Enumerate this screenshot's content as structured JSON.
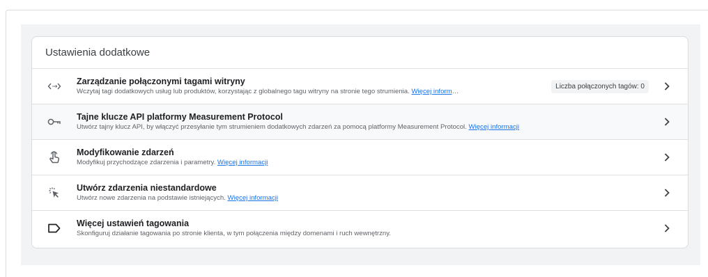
{
  "card": {
    "title": "Ustawienia dodatkowe"
  },
  "rows": [
    {
      "icon": "code-brackets-icon",
      "title": "Zarządzanie połączonymi tagami witryny",
      "description": "Wczytaj tagi dodatkowych usług lub produktów, korzystając z globalnego tagu witryny na stronie tego strumienia. ",
      "link": "Więcej inform",
      "ellipsis": "…",
      "badge": "Liczba połączonych tagów: 0"
    },
    {
      "icon": "key-icon",
      "title": "Tajne klucze API platformy Measurement Protocol",
      "description": "Utwórz tajny klucz API, by włączyć przesyłanie tym strumieniem dodatkowych zdarzeń za pomocą platformy Measurement Protocol. ",
      "link": "Więcej informacji"
    },
    {
      "icon": "touch-hand-icon",
      "title": "Modyfikowanie zdarzeń",
      "description": "Modyfikuj przychodzące zdarzenia i parametry. ",
      "link": "Więcej informacji"
    },
    {
      "icon": "click-sparkle-icon",
      "title": "Utwórz zdarzenia niestandardowe",
      "description": "Utwórz nowe zdarzenia na podstawie istniejących. ",
      "link": "Więcej informacji"
    },
    {
      "icon": "label-tag-icon",
      "title": "Więcej ustawień tagowania",
      "description": "Skonfiguruj działanie tagowania po stronie klienta, w tym połączenia między domenami i ruch wewnętrzny."
    }
  ]
}
